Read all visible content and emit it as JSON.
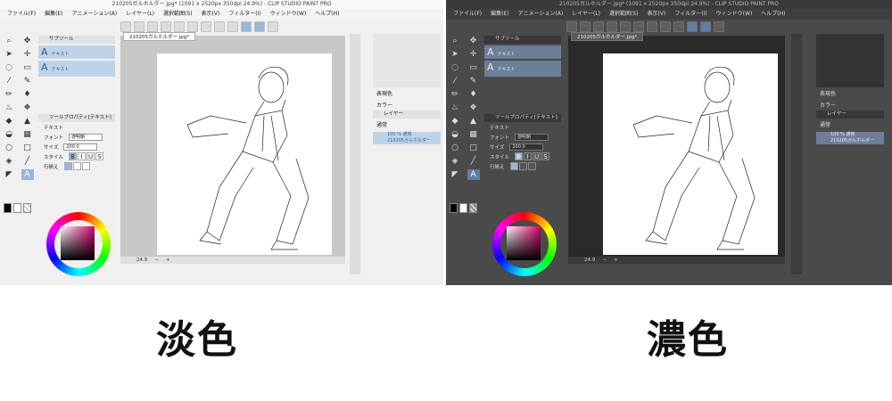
{
  "window_title": "210205ガルホルダー.jpg* (1091 x 2520px 350dpi 24.9%) - CLIP STUDIO PAINT PRO",
  "menu": [
    "ファイル(F)",
    "編集(E)",
    "アニメーション(A)",
    "レイヤー(L)",
    "選択範囲(S)",
    "表示(V)",
    "フィルター(I)",
    "ウィンドウ(W)",
    "ヘルプ(H)"
  ],
  "doc_tab": "210205ガルホルダー.jpg*",
  "subtool": {
    "tab": "サブツール",
    "items": [
      "テキスト",
      "テキスト"
    ]
  },
  "tool_property": {
    "tab": "ツールプロパティ[テキスト]",
    "section": "テキスト",
    "font_label": "フォント",
    "font_value": "游明朝",
    "size_label": "サイズ",
    "size_value": "200.0",
    "style_label": "スタイル",
    "style_buttons": [
      "B",
      "I",
      "U",
      "S"
    ],
    "align_label": "行揃え"
  },
  "layer_panel": {
    "tab": "レイヤー",
    "blend": "通常",
    "layer_name": "100 % 通常",
    "layer_sub": "210205ガルホルダー"
  },
  "status": {
    "zoom": "24.9"
  },
  "right_labels": {
    "color_label": "表現色",
    "color_value": "カラー"
  },
  "captions": {
    "light": "淡色",
    "dark": "濃色"
  },
  "colors": {
    "light_bg": "#f0f0f0",
    "dark_bg": "#4a4a4a",
    "accent": "#9ab6d8"
  }
}
